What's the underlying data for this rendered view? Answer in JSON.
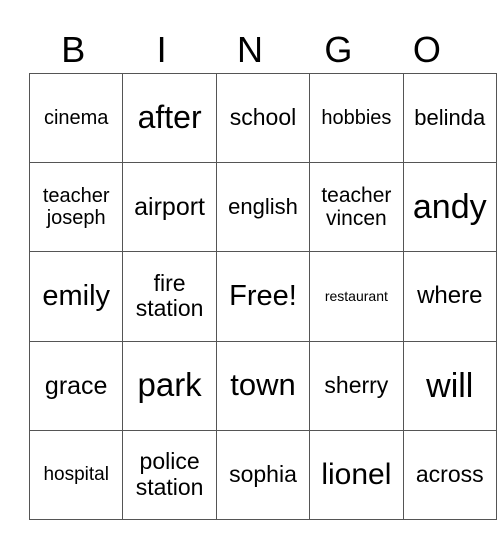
{
  "header": [
    "B",
    "I",
    "N",
    "G",
    "O"
  ],
  "rows": [
    [
      {
        "t": "cinema",
        "s": 20
      },
      {
        "t": "after",
        "s": 32
      },
      {
        "t": "school",
        "s": 23
      },
      {
        "t": "hobbies",
        "s": 20
      },
      {
        "t": "belinda",
        "s": 22
      }
    ],
    [
      {
        "t": "teacher joseph",
        "s": 20
      },
      {
        "t": "airport",
        "s": 25
      },
      {
        "t": "english",
        "s": 22
      },
      {
        "t": "teacher vincen",
        "s": 21
      },
      {
        "t": "andy",
        "s": 34
      }
    ],
    [
      {
        "t": "emily",
        "s": 29
      },
      {
        "t": "fire station",
        "s": 23
      },
      {
        "t": "Free!",
        "s": 29
      },
      {
        "t": "restaurant",
        "s": 14
      },
      {
        "t": "where",
        "s": 24
      }
    ],
    [
      {
        "t": "grace",
        "s": 25
      },
      {
        "t": "park",
        "s": 33
      },
      {
        "t": "town",
        "s": 31
      },
      {
        "t": "sherry",
        "s": 23
      },
      {
        "t": "will",
        "s": 34
      }
    ],
    [
      {
        "t": "hospital",
        "s": 19
      },
      {
        "t": "police station",
        "s": 23
      },
      {
        "t": "sophia",
        "s": 23
      },
      {
        "t": "lionel",
        "s": 30
      },
      {
        "t": "across",
        "s": 23
      }
    ]
  ]
}
